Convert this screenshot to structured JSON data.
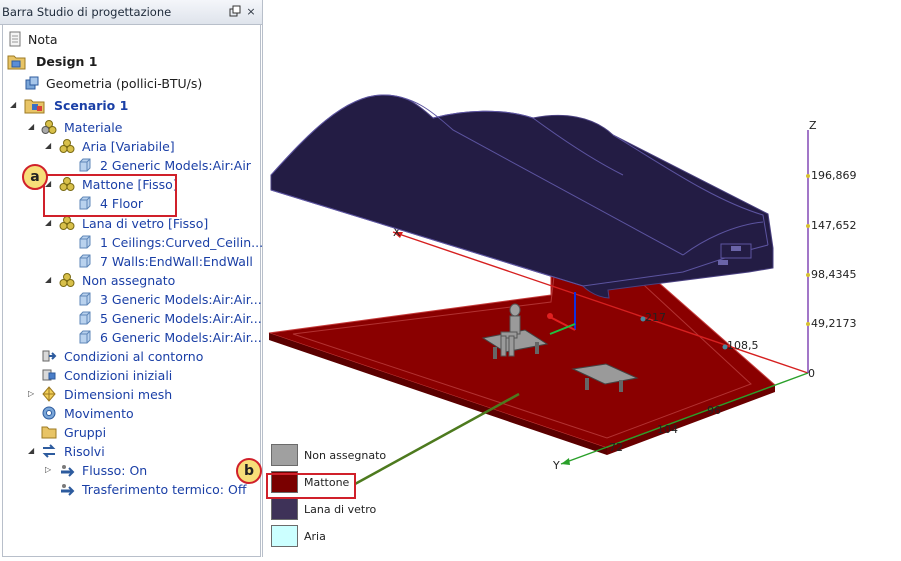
{
  "panel": {
    "title": "Barra Studio di progettazione",
    "pin_icon": "restore-icon",
    "close_label": "×"
  },
  "tree": {
    "nota": "Nota",
    "design": "Design 1",
    "geometria": "Geometria (pollici-BTU/s)",
    "scenario": "Scenario 1",
    "materiale": "Materiale",
    "aria": "Aria [Variabile]",
    "aria_item": "2 Generic Models:Air:Air",
    "mattone": "Mattone [Fisso]",
    "mattone_item": "4 Floor",
    "lana": "Lana di vetro [Fisso]",
    "lana_item1": "1 Ceilings:Curved_Ceilin...",
    "lana_item2": "7 Walls:EndWall:EndWall",
    "non_assegnato": "Non assegnato",
    "na_item1": "3 Generic Models:Air:Air...",
    "na_item2": "5 Generic Models:Air:Air...",
    "na_item3": "6 Generic Models:Air:Air...",
    "condizioni_contorno": "Condizioni al contorno",
    "condizioni_iniziali": "Condizioni iniziali",
    "dimensioni_mesh": "Dimensioni mesh",
    "movimento": "Movimento",
    "gruppi": "Gruppi",
    "risolvi": "Risolvi",
    "flusso": "Flusso: On",
    "trasferimento": "Trasferimento termico: Off"
  },
  "callouts": {
    "a": "a",
    "b": "b"
  },
  "legend": [
    {
      "label": "Non assegnato",
      "color": "#a0a0a0"
    },
    {
      "label": "Mattone",
      "color": "#7a0000"
    },
    {
      "label": "Lana di vetro",
      "color": "#3e3258"
    },
    {
      "label": "Aria",
      "color": "#ccffff"
    }
  ],
  "scale": {
    "z_label": "Z",
    "y_label": "Y",
    "x_label": "X",
    "ticks": [
      "196,869",
      "147,652",
      "98,4345",
      "49,2173",
      "0"
    ],
    "x_ticks": [
      "217",
      "108,5"
    ],
    "y_ticks": [
      "96",
      "104",
      "72"
    ]
  },
  "colors": {
    "floor": "#7a0000",
    "roof": "#231c44",
    "link": "#1a3fa6",
    "callout": "#d0202a"
  }
}
